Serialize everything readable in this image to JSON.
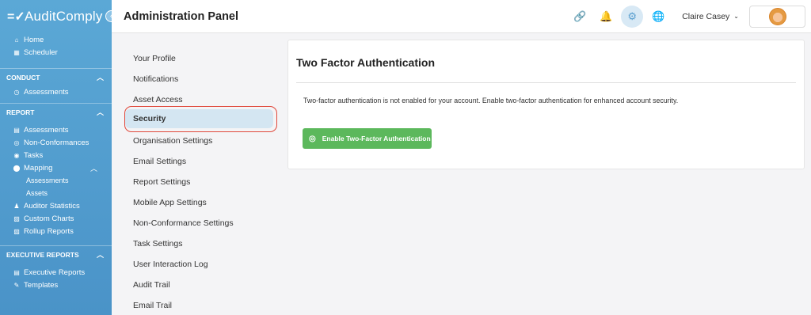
{
  "app": {
    "brand_logo": "=✓",
    "brand_name": "AuditComply",
    "collapse_glyph": "‹"
  },
  "sidebar": {
    "top_items": [
      {
        "icon": "home-icon",
        "glyph": "⌂",
        "label": "Home"
      },
      {
        "icon": "calendar-icon",
        "glyph": "▦",
        "label": "Scheduler"
      }
    ],
    "conduct": {
      "title": "CONDUCT",
      "items": [
        {
          "icon": "clock-icon",
          "glyph": "◷",
          "label": "Assessments"
        }
      ]
    },
    "report": {
      "title": "REPORT",
      "items": [
        {
          "icon": "list-icon",
          "glyph": "▤",
          "label": "Assessments"
        },
        {
          "icon": "search-doc-icon",
          "glyph": "◎",
          "label": "Non-Conformances"
        },
        {
          "icon": "tasks-icon",
          "glyph": "◉",
          "label": "Tasks"
        },
        {
          "icon": "map-pin-icon",
          "glyph": "⬤",
          "label": "Mapping"
        }
      ],
      "mapping_sub": [
        "Assessments",
        "Assets"
      ],
      "items_after": [
        {
          "icon": "users-icon",
          "glyph": "♟",
          "label": "Auditor Statistics"
        },
        {
          "icon": "chart-icon",
          "glyph": "▨",
          "label": "Custom Charts"
        },
        {
          "icon": "chart-icon",
          "glyph": "▨",
          "label": "Rollup Reports"
        }
      ]
    },
    "executive": {
      "title": "EXECUTIVE REPORTS",
      "items": [
        {
          "icon": "list-icon",
          "glyph": "▤",
          "label": "Executive Reports"
        },
        {
          "icon": "edit-icon",
          "glyph": "✎",
          "label": "Templates"
        }
      ]
    },
    "chevron_up": "︿"
  },
  "header": {
    "title": "Administration Panel",
    "icons": [
      {
        "name": "link-icon",
        "glyph": "🔗"
      },
      {
        "name": "bell-icon",
        "glyph": "🔔"
      },
      {
        "name": "gear-icon",
        "glyph": "⚙"
      },
      {
        "name": "globe-icon",
        "glyph": "🌐"
      }
    ],
    "user_name": "Claire Casey",
    "user_chevron": "⌄"
  },
  "settings_menu": {
    "items": [
      "Your Profile",
      "Notifications",
      "Asset Access",
      "Security",
      "Organisation Settings",
      "Email Settings",
      "Report Settings",
      "Mobile App Settings",
      "Non-Conformance Settings",
      "Task Settings",
      "User Interaction Log",
      "Audit Trail",
      "Email Trail"
    ],
    "selected": "Security"
  },
  "card": {
    "title": "Two Factor Authentication",
    "text": "Two-factor authentication is not enabled for your account. Enable two-factor authentication for enhanced account security.",
    "button_label": "Enable Two-Factor Authentication",
    "button_icon": "fingerprint-icon",
    "button_glyph": "◎"
  },
  "colors": {
    "sidebar": "#5ba8d6",
    "accent": "#5ba0d0",
    "button_green": "#5cb85c",
    "highlight_outline": "#e0473a"
  }
}
